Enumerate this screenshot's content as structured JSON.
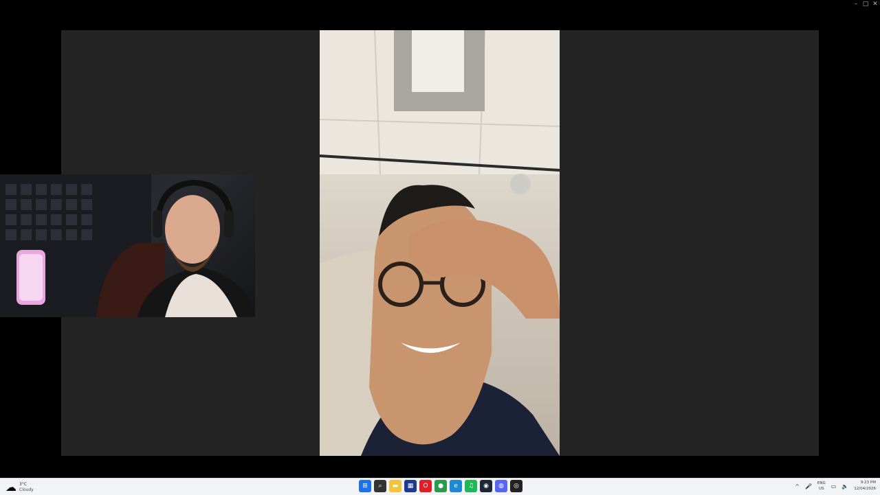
{
  "window_controls": {
    "minimize": "–",
    "maximize": "□",
    "close": "✕"
  },
  "taskbar": {
    "weather": {
      "temperature": "3°C",
      "condition": "Cloudy",
      "icon": "cloud-icon"
    },
    "apps": [
      {
        "name": "windows-start-icon",
        "glyph": "⊞",
        "color": "#1a73e8"
      },
      {
        "name": "search-icon",
        "glyph": "⌕",
        "color": "#333"
      },
      {
        "name": "file-explorer-icon",
        "glyph": "▬",
        "color": "#f3c33c"
      },
      {
        "name": "calendar-app-icon",
        "glyph": "▦",
        "color": "#1e3a8a"
      },
      {
        "name": "opera-icon",
        "glyph": "O",
        "color": "#e01e2a"
      },
      {
        "name": "chrome-icon",
        "glyph": "●",
        "color": "#2c9a4c"
      },
      {
        "name": "edge-icon",
        "glyph": "e",
        "color": "#1b8ad3"
      },
      {
        "name": "spotify-icon",
        "glyph": "♫",
        "color": "#1db954"
      },
      {
        "name": "steam-icon",
        "glyph": "◉",
        "color": "#1b2838"
      },
      {
        "name": "discord-icon",
        "glyph": "◍",
        "color": "#5865f2"
      },
      {
        "name": "obs-icon",
        "glyph": "◎",
        "color": "#222"
      }
    ],
    "tray": {
      "chevron": "^",
      "language": "ENG",
      "region": "US",
      "time": "9:23 PM",
      "date": "12/04/2026"
    }
  }
}
